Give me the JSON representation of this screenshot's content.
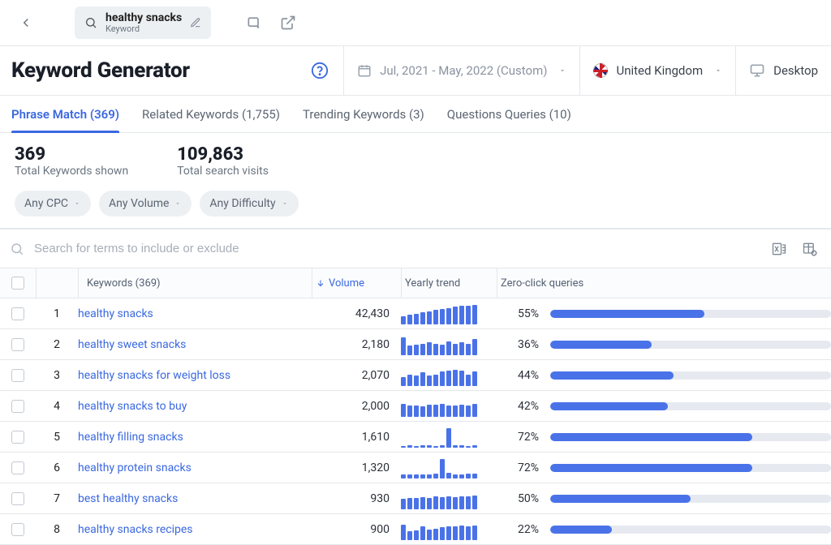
{
  "top": {
    "keyword": "healthy snacks",
    "keyword_type": "Keyword"
  },
  "header": {
    "title": "Keyword Generator",
    "date_range": "Jul, 2021 - May, 2022 (Custom)",
    "country": "United Kingdom",
    "device": "Desktop"
  },
  "tabs": [
    {
      "label": "Phrase Match (369)",
      "active": true
    },
    {
      "label": "Related Keywords (1,755)",
      "active": false
    },
    {
      "label": "Trending Keywords (3)",
      "active": false
    },
    {
      "label": "Questions Queries (10)",
      "active": false
    }
  ],
  "stats": {
    "total_keywords_value": "369",
    "total_keywords_label": "Total Keywords shown",
    "total_visits_value": "109,863",
    "total_visits_label": "Total search visits"
  },
  "filters": {
    "cpc": "Any CPC",
    "volume": "Any Volume",
    "difficulty": "Any Difficulty"
  },
  "search": {
    "placeholder": "Search for terms to include or exclude"
  },
  "table": {
    "headers": {
      "keywords": "Keywords (369)",
      "volume": "Volume",
      "trend": "Yearly trend",
      "zero": "Zero-click queries"
    },
    "rows": [
      {
        "idx": "1",
        "keyword": "healthy snacks",
        "volume": "42,430",
        "zero_pct": "55%",
        "zero_val": 55,
        "spark": [
          40,
          48,
          55,
          62,
          68,
          74,
          80,
          85,
          90,
          94,
          97,
          100
        ]
      },
      {
        "idx": "2",
        "keyword": "healthy sweet snacks",
        "volume": "2,180",
        "zero_pct": "36%",
        "zero_val": 36,
        "spark": [
          90,
          50,
          55,
          60,
          65,
          60,
          55,
          70,
          60,
          65,
          60,
          85
        ]
      },
      {
        "idx": "3",
        "keyword": "healthy snacks for weight loss",
        "volume": "2,070",
        "zero_pct": "44%",
        "zero_val": 44,
        "spark": [
          45,
          60,
          55,
          70,
          55,
          60,
          75,
          80,
          85,
          80,
          60,
          75
        ]
      },
      {
        "idx": "4",
        "keyword": "healthy snacks to buy",
        "volume": "2,000",
        "zero_pct": "42%",
        "zero_val": 42,
        "spark": [
          65,
          60,
          58,
          55,
          62,
          64,
          66,
          60,
          58,
          62,
          60,
          65
        ]
      },
      {
        "idx": "5",
        "keyword": "healthy filling snacks",
        "volume": "1,610",
        "zero_pct": "72%",
        "zero_val": 72,
        "spark": [
          10,
          12,
          10,
          11,
          12,
          10,
          11,
          100,
          12,
          11,
          10,
          12
        ]
      },
      {
        "idx": "6",
        "keyword": "healthy protein snacks",
        "volume": "1,320",
        "zero_pct": "72%",
        "zero_val": 72,
        "spark": [
          20,
          22,
          21,
          20,
          22,
          24,
          100,
          28,
          21,
          22,
          23,
          24
        ]
      },
      {
        "idx": "7",
        "keyword": "best healthy snacks",
        "volume": "930",
        "zero_pct": "50%",
        "zero_val": 50,
        "spark": [
          55,
          60,
          58,
          62,
          60,
          65,
          63,
          66,
          64,
          68,
          66,
          70
        ]
      },
      {
        "idx": "8",
        "keyword": "healthy snacks recipes",
        "volume": "900",
        "zero_pct": "22%",
        "zero_val": 22,
        "spark": [
          80,
          45,
          50,
          70,
          55,
          60,
          65,
          70,
          72,
          74,
          70,
          75
        ]
      }
    ]
  }
}
